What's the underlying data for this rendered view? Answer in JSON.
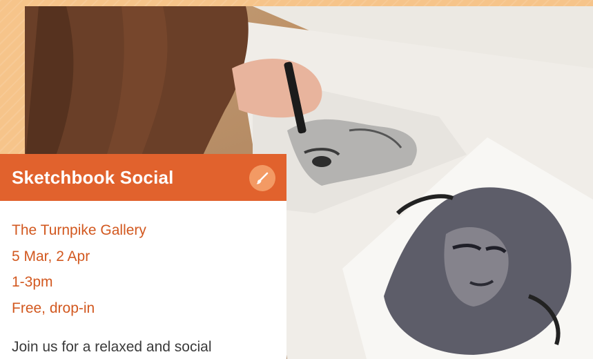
{
  "event": {
    "title": "Sketchbook Social",
    "badge_icon": "paintbrush-icon",
    "venue": "The Turnpike Gallery",
    "dates": "5 Mar, 2 Apr",
    "time": "1-3pm",
    "price": "Free, drop-in",
    "description": "Join us for a relaxed and social"
  },
  "colors": {
    "header_bg": "#e1622d",
    "detail_text": "#d2581f",
    "page_bg": "#f6c48a",
    "badge_bg": "#f39a64"
  }
}
